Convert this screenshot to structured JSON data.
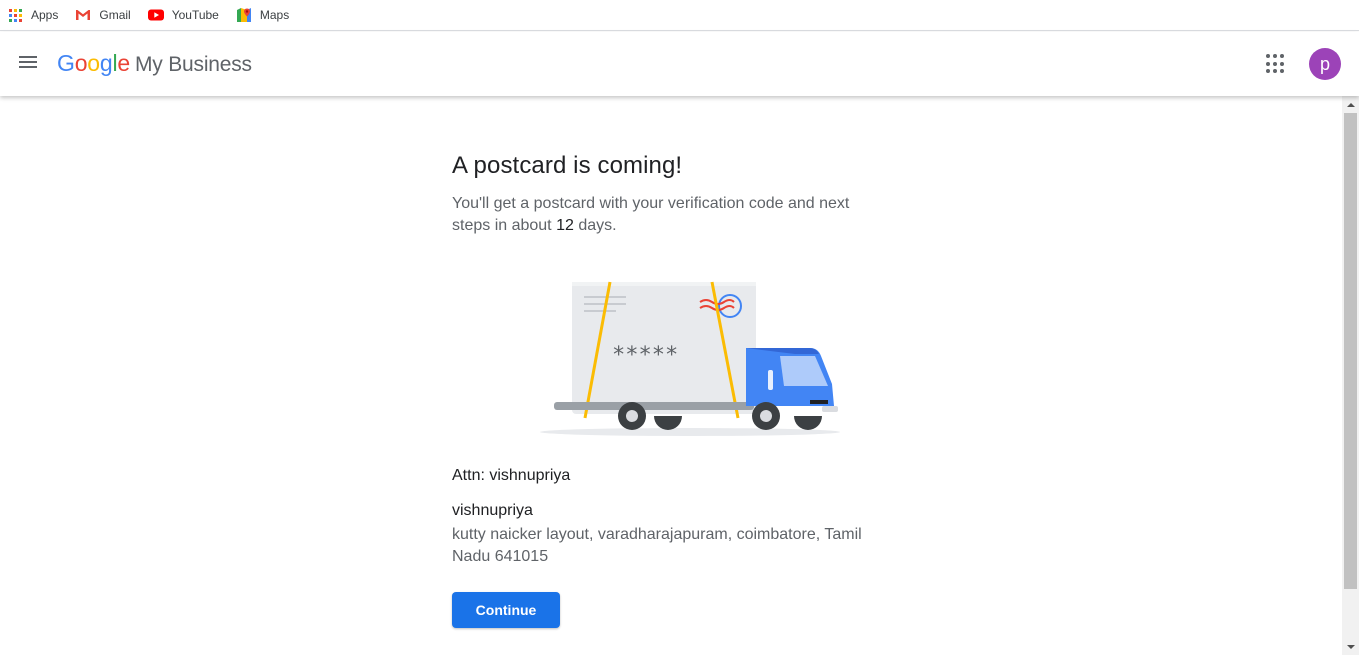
{
  "bookmarks": [
    {
      "label": "Apps",
      "icon": "apps-grid-icon"
    },
    {
      "label": "Gmail",
      "icon": "gmail-icon"
    },
    {
      "label": "YouTube",
      "icon": "youtube-icon"
    },
    {
      "label": "Maps",
      "icon": "maps-icon"
    }
  ],
  "header": {
    "logo_google": "Google",
    "product": "My Business",
    "avatar_initial": "p",
    "avatar_color": "#9c43b8"
  },
  "main": {
    "title": "A postcard is coming!",
    "desc_before": "You'll get a postcard with your verification code and next steps in about ",
    "desc_days": "12",
    "desc_after": " days.",
    "postcard_code": "*****",
    "attn": "Attn: vishnupriya",
    "recipient": "vishnupriya",
    "address": "kutty naicker layout, varadharajapuram, coimbatore, Tamil Nadu 641015",
    "continue_label": "Continue"
  },
  "colors": {
    "accent": "#1a73e8",
    "truck_blue": "#4285f4"
  }
}
